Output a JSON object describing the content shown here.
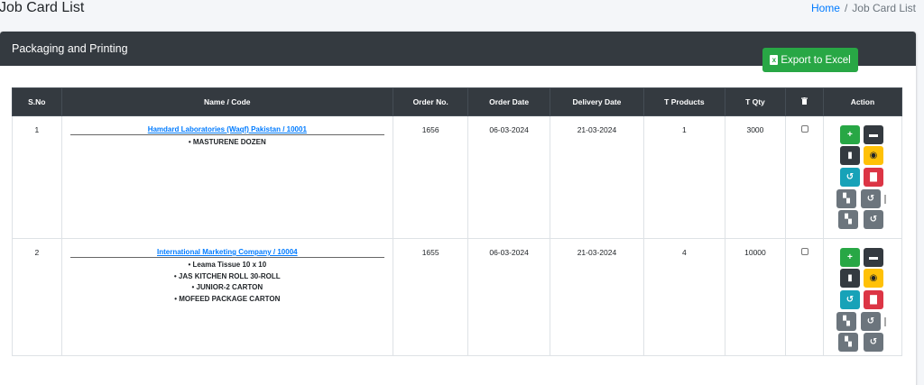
{
  "page": {
    "title": "Job Card List"
  },
  "breadcrumb": {
    "home": "Home",
    "current": "Job Card List"
  },
  "card": {
    "title": "Packaging and Printing"
  },
  "toolbar": {
    "export_label": "Export to Excel",
    "export_icon": "excel-icon"
  },
  "table": {
    "columns": [
      "S.No",
      "Name / Code",
      "Order No.",
      "Order Date",
      "Delivery Date",
      "T Products",
      "T Qty",
      "",
      "Action"
    ],
    "rows": [
      {
        "sno": "1",
        "client": "Hamdard Laboratories (Waqf) Pakistan / 10001",
        "products": [
          "• MASTURENE DOZEN"
        ],
        "order_no": "1656",
        "order_date": "06-03-2024",
        "delivery_date": "21-03-2024",
        "t_products": "1",
        "t_qty": "3000"
      },
      {
        "sno": "2",
        "client": "International Marketing Company / 10004",
        "products": [
          "• Leama Tissue 10 x 10",
          "• JAS KITCHEN ROLL 30-ROLL",
          "• JUNIOR-2 CARTON",
          "• MOFEED PACKAGE CARTON"
        ],
        "order_no": "1655",
        "order_date": "06-03-2024",
        "delivery_date": "21-03-2024",
        "t_products": "4",
        "t_qty": "10000"
      }
    ]
  },
  "colors": {
    "header_dark": "#343a40",
    "link": "#007bff",
    "success": "#28a745",
    "warning": "#ffc107",
    "info": "#17a2b8",
    "danger": "#dc3545",
    "secondary": "#6c757d"
  }
}
